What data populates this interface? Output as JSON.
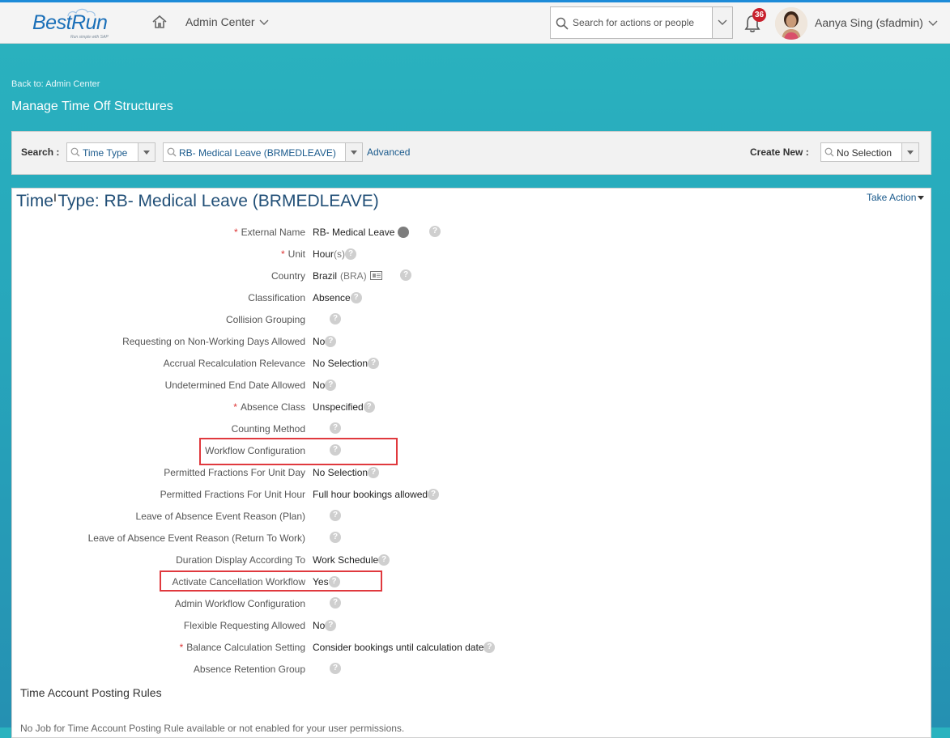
{
  "brand": {
    "logo_text": "BestRun",
    "logo_tagline": "Run simple with SAP"
  },
  "shell": {
    "nav_title": "Admin Center",
    "search_placeholder": "Search for actions or people",
    "notification_count": "36",
    "user_name": "Aanya Sing (sfadmin)"
  },
  "page": {
    "back_link": "Back to: Admin Center",
    "title": "Manage Time Off Structures"
  },
  "search_bar": {
    "search_label": "Search :",
    "type_value": "Time Type",
    "item_value": "RB- Medical Leave (BRMEDLEAVE)",
    "advanced_label": "Advanced",
    "create_label": "Create New :",
    "create_value": "No Selection"
  },
  "detail": {
    "title": "Time Type: RB- Medical Leave (BRMEDLEAVE)",
    "take_action": "Take Action",
    "fields": [
      {
        "label": "External Name",
        "required": true,
        "value": "RB- Medical Leave",
        "extra": ""
      },
      {
        "label": "Unit",
        "required": true,
        "value": "Hour",
        "extra": "(s)"
      },
      {
        "label": "Country",
        "required": false,
        "value": "Brazil",
        "extra": "(BRA)"
      },
      {
        "label": "Classification",
        "required": false,
        "value": "Absence",
        "extra": ""
      },
      {
        "label": "Collision Grouping",
        "required": false,
        "value": "",
        "extra": ""
      },
      {
        "label": "Requesting on Non-Working Days Allowed",
        "required": false,
        "value": "No",
        "extra": ""
      },
      {
        "label": "Accrual Recalculation Relevance",
        "required": false,
        "value": "No Selection",
        "extra": ""
      },
      {
        "label": "Undetermined End Date Allowed",
        "required": false,
        "value": "No",
        "extra": ""
      },
      {
        "label": "Absence Class",
        "required": true,
        "value": "Unspecified",
        "extra": ""
      },
      {
        "label": "Counting Method",
        "required": false,
        "value": "",
        "extra": ""
      },
      {
        "label": "Workflow Configuration",
        "required": false,
        "value": "",
        "extra": ""
      },
      {
        "label": "Permitted Fractions For Unit Day",
        "required": false,
        "value": "No Selection",
        "extra": ""
      },
      {
        "label": "Permitted Fractions For Unit Hour",
        "required": false,
        "value": "Full hour bookings allowed",
        "extra": ""
      },
      {
        "label": "Leave of Absence Event Reason (Plan)",
        "required": false,
        "value": "",
        "extra": ""
      },
      {
        "label": "Leave of Absence Event Reason (Return To Work)",
        "required": false,
        "value": "",
        "extra": ""
      },
      {
        "label": "Duration Display According To",
        "required": false,
        "value": "Work Schedule",
        "extra": ""
      },
      {
        "label": "Activate Cancellation Workflow",
        "required": false,
        "value": "Yes",
        "extra": ""
      },
      {
        "label": "Admin Workflow Configuration",
        "required": false,
        "value": "",
        "extra": ""
      },
      {
        "label": "Flexible Requesting Allowed",
        "required": false,
        "value": "No",
        "extra": ""
      },
      {
        "label": "Balance Calculation Setting",
        "required": true,
        "value": "Consider bookings until calculation date",
        "extra": ""
      },
      {
        "label": "Absence Retention Group",
        "required": false,
        "value": "",
        "extra": ""
      }
    ],
    "required_marker": "*",
    "help_glyph": "?",
    "posting_rules_title": "Time Account Posting Rules",
    "posting_rules_text": "No Job for Time Account Posting Rule available or not enabled for your user permissions."
  },
  "colors": {
    "accent": "#1a5a8c",
    "highlight": "#e0393e",
    "required": "#dd3333"
  },
  "icons": [
    "home-icon",
    "chevron-down-icon",
    "search-icon",
    "bell-icon",
    "avatar",
    "help-icon",
    "globe-icon",
    "card-icon"
  ]
}
